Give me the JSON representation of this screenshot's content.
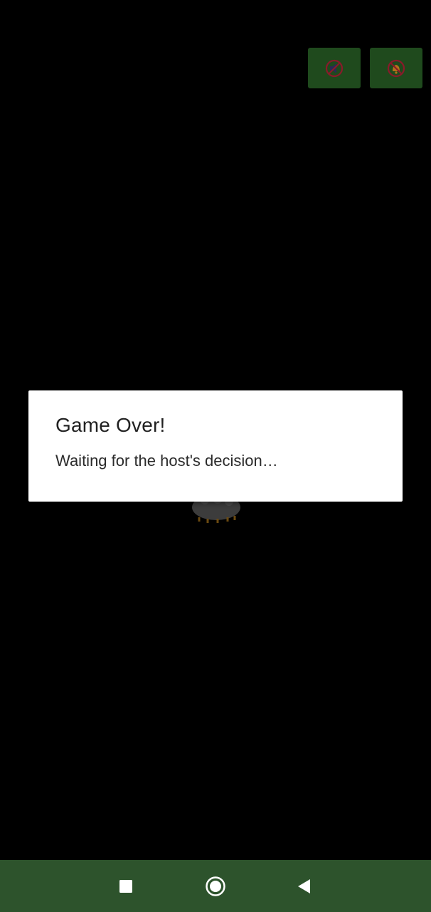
{
  "top_controls": {
    "sound_icon": "speaker-muted-icon",
    "notify_icon": "bell-muted-icon"
  },
  "dialog": {
    "title": "Game Over!",
    "message": "Waiting for the host's decision…"
  },
  "navbar": {
    "recents_icon": "square-recents-icon",
    "home_icon": "circle-home-icon",
    "back_icon": "triangle-back-icon"
  },
  "colors": {
    "background": "#000000",
    "button_bg": "#1f4a1d",
    "navbar_bg": "#2d532c",
    "dialog_bg": "#ffffff"
  }
}
